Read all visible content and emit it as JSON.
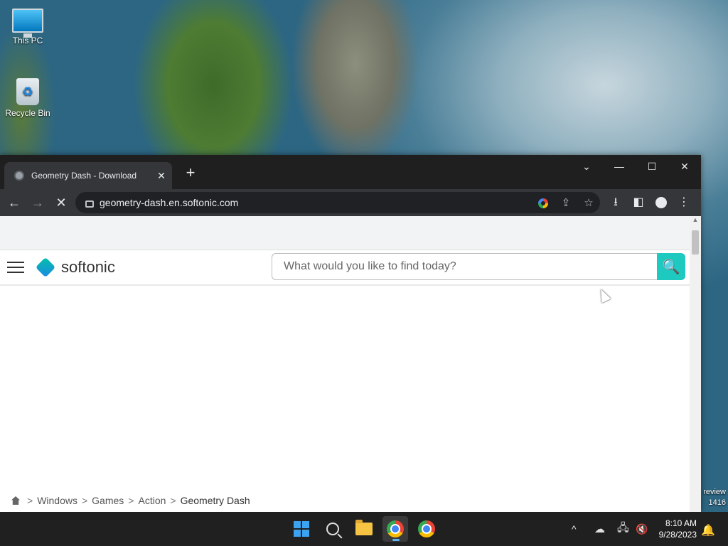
{
  "desktop": {
    "icons": [
      {
        "label": "This PC"
      },
      {
        "label": "Recycle Bin"
      }
    ],
    "watermark_lines": [
      "review",
      "1416"
    ]
  },
  "browser": {
    "tab": {
      "title": "Geometry Dash - Download",
      "close": "✕"
    },
    "new_tab": "+",
    "window_controls": {
      "dropdown": "⌄",
      "minimize": "—",
      "maximize": "☐",
      "close": "✕"
    },
    "nav": {
      "back": "←",
      "forward": "→",
      "stop": "✕"
    },
    "url": "geometry-dash.en.softonic.com",
    "omnibox_icons": {
      "share": "⇪",
      "bookmark": "☆"
    },
    "toolbar_icons": {
      "download": "⭳",
      "sidepanel": "◧",
      "menu": "⋮"
    }
  },
  "page": {
    "logo_text": "softonic",
    "search_placeholder": "What would you like to find today?",
    "search_button": "🔍",
    "breadcrumb": [
      {
        "label": "Windows"
      },
      {
        "label": "Games"
      },
      {
        "label": "Action"
      },
      {
        "label": "Geometry Dash"
      }
    ],
    "breadcrumb_sep": ">"
  },
  "taskbar": {
    "tray_chevron": "^",
    "clock": {
      "time": "8:10 AM",
      "date": "9/28/2023"
    }
  }
}
